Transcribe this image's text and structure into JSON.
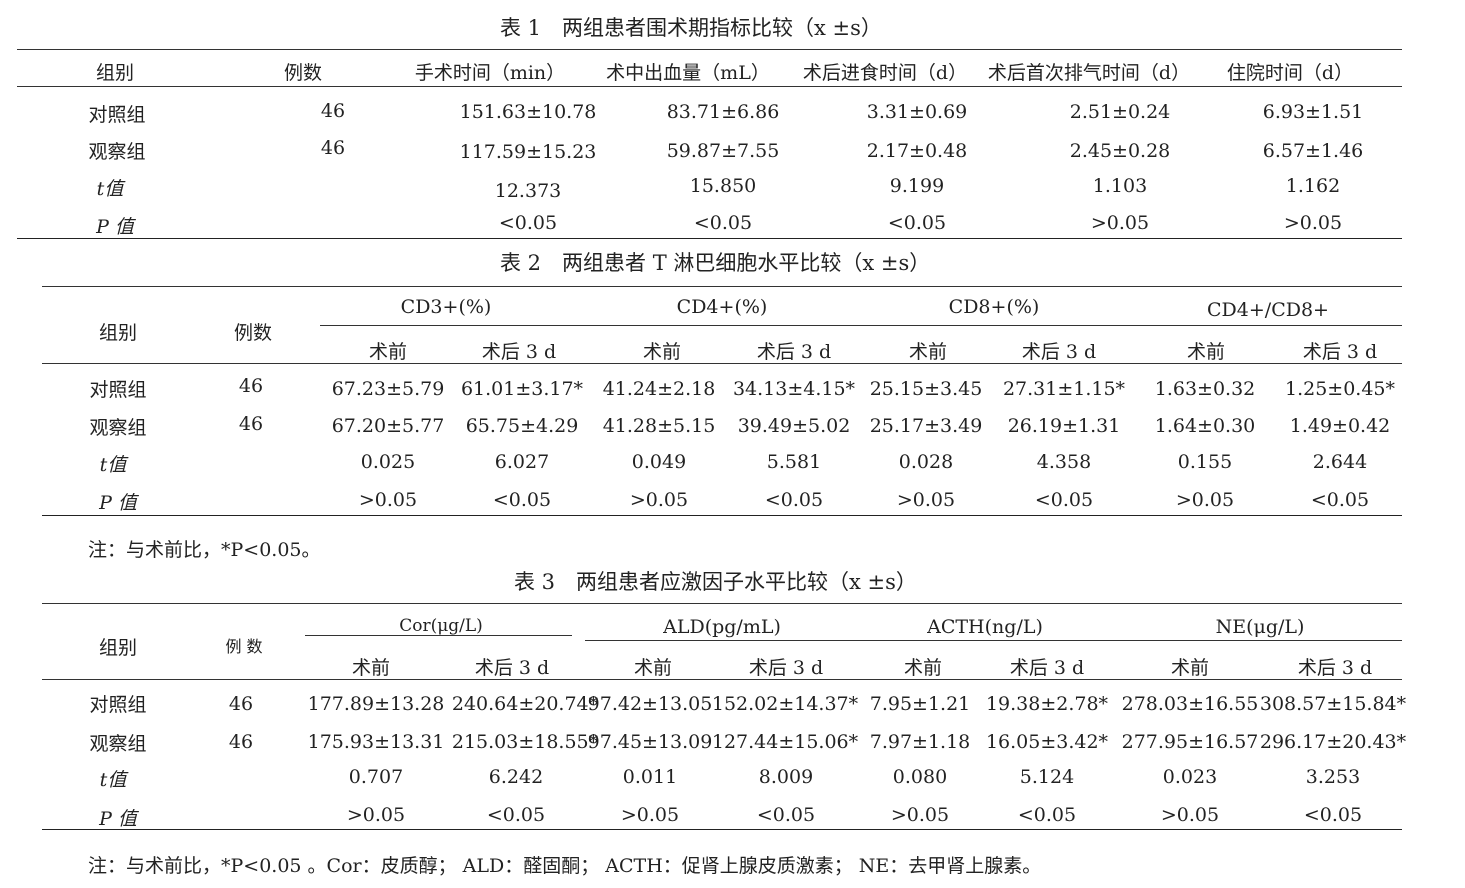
{
  "table1": {
    "title": "表 1　两组患者围术期指标比较（x ±s）",
    "headers": [
      "组别",
      "例数",
      "手术时间（min）",
      "术中出血量（mL）",
      "术后进食时间（d）",
      "术后首次排气时间（d）",
      "住院时间（d）"
    ],
    "rows": [
      {
        "group": "对照组",
        "n": "46",
        "values": [
          "151.63±10.78",
          "83.71±6.86",
          "3.31±0.69",
          "2.51±0.24",
          "6.93±1.51"
        ]
      },
      {
        "group": "观察组",
        "n": "46",
        "values": [
          "117.59±15.23",
          "59.87±7.55",
          "2.17±0.48",
          "2.45±0.28",
          "6.57±1.46"
        ]
      },
      {
        "group": "t值",
        "n": "",
        "values": [
          "12.373",
          "15.850",
          "9.199",
          "1.103",
          "1.162"
        ]
      },
      {
        "group": "P 值",
        "n": "",
        "values": [
          "<0.05",
          "<0.05",
          "<0.05",
          ">0.05",
          ">0.05"
        ]
      }
    ]
  },
  "table2": {
    "title": "表 2　两组患者 T 淋巴细胞水平比较（x ±s）",
    "group_header": "组别",
    "n_header": "例数",
    "col_groups": [
      "CD3+(%)",
      "CD4+(%)",
      "CD8+(%)",
      "CD4+/CD8+"
    ],
    "sub_headers": [
      "术前",
      "术后 3 d",
      "术前",
      "术后 3 d",
      "术前",
      "术后 3 d",
      "术前",
      "术后 3 d"
    ],
    "rows": [
      {
        "group": "对照组",
        "n": "46",
        "values": [
          "67.23±5.79",
          "61.01±3.17*",
          "41.24±2.18",
          "34.13±4.15*",
          "25.15±3.45",
          "27.31±1.15*",
          "1.63±0.32",
          "1.25±0.45*"
        ]
      },
      {
        "group": "观察组",
        "n": "46",
        "values": [
          "67.20±5.77",
          "65.75±4.29",
          "41.28±5.15",
          "39.49±5.02",
          "25.17±3.49",
          "26.19±1.31",
          "1.64±0.30",
          "1.49±0.42"
        ]
      },
      {
        "group": "t值",
        "n": "",
        "values": [
          "0.025",
          "6.027",
          "0.049",
          "5.581",
          "0.028",
          "4.358",
          "0.155",
          "2.644"
        ]
      },
      {
        "group": "P 值",
        "n": "",
        "values": [
          ">0.05",
          "<0.05",
          ">0.05",
          "<0.05",
          ">0.05",
          "<0.05",
          ">0.05",
          "<0.05"
        ]
      }
    ],
    "note": "注：与术前比，*P<0.05。"
  },
  "table3": {
    "title": "表 3　两组患者应激因子水平比较（x ±s）",
    "group_header": "组别",
    "n_header": "例 数",
    "col_groups": [
      "Cor(μg/L)",
      "ALD(pg/mL)",
      "ACTH(ng/L)",
      "NE(μg/L)"
    ],
    "sub_headers": [
      "术前",
      "术后 3 d",
      "术前",
      "术后 3 d",
      "术前",
      "术后 3 d",
      "术前",
      "术后 3 d"
    ],
    "rows": [
      {
        "group": "对照组",
        "n": "46",
        "values": [
          "177.89±13.28",
          "240.64±20.74*",
          "97.42±13.05",
          "152.02±14.37*",
          "7.95±1.21",
          "19.38±2.78*",
          "278.03±16.55",
          "308.57±15.84*"
        ]
      },
      {
        "group": "观察组",
        "n": "46",
        "values": [
          "175.93±13.31",
          "215.03±18.55*",
          "97.45±13.09",
          "127.44±15.06*",
          "7.97±1.18",
          "16.05±3.42*",
          "277.95±16.57",
          "296.17±20.43*"
        ]
      },
      {
        "group": "t值",
        "n": "",
        "values": [
          "0.707",
          "6.242",
          "0.011",
          "8.009",
          "0.080",
          "5.124",
          "0.023",
          "3.253"
        ]
      },
      {
        "group": "P 值",
        "n": "",
        "values": [
          ">0.05",
          "<0.05",
          ">0.05",
          "<0.05",
          ">0.05",
          "<0.05",
          ">0.05",
          "<0.05"
        ]
      }
    ],
    "note": "注：与术前比，*P<0.05 。Cor：皮质醇； ALD：醛固酮； ACTH：促肾上腺皮质激素； NE：去甲肾上腺素。"
  }
}
